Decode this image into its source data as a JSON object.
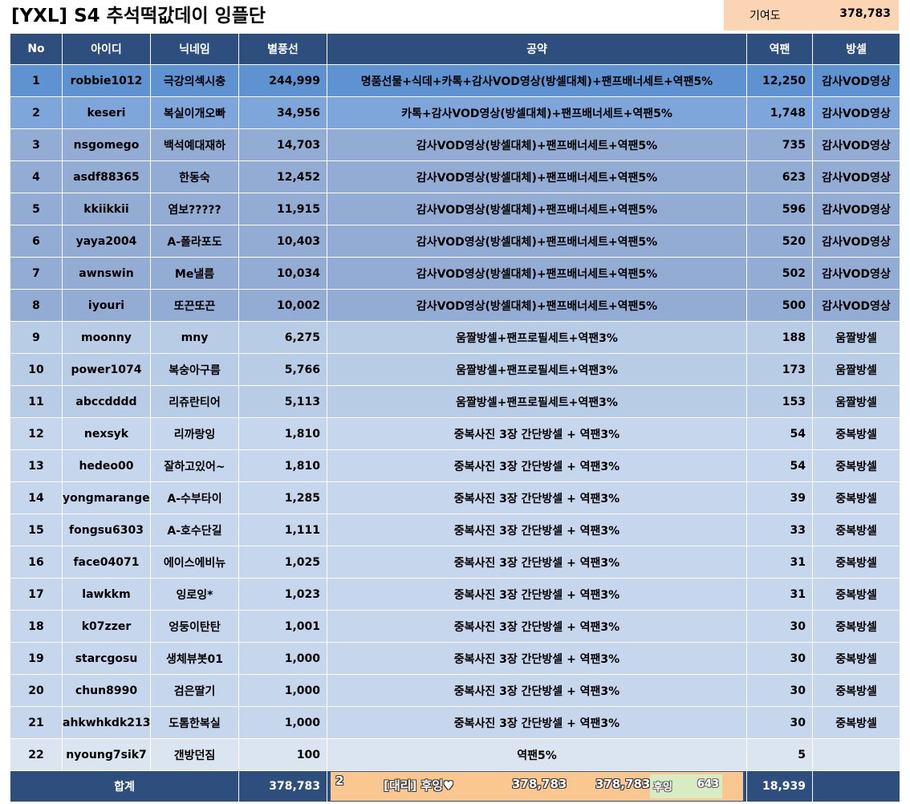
{
  "title": "[YXL] S4 추석떡값데이 잉플단",
  "contribution": {
    "label": "기여도",
    "value": "378,783"
  },
  "headers": [
    "No",
    "아이디",
    "닉네임",
    "별풍선",
    "공약",
    "역팬",
    "방셀"
  ],
  "rows": [
    {
      "no": "1",
      "id": "robbie1012",
      "nick": "극강의섹시충",
      "balloons": "244,999",
      "promise": "명품선물+식데+카톡+감사VOD영상(방셀대체)+팬프배너세트+역팬5%",
      "fan": "12,250",
      "cell": "감사VOD영상",
      "tone": "t1"
    },
    {
      "no": "2",
      "id": "keseri",
      "nick": "복실이개오빠",
      "balloons": "34,956",
      "promise": "카톡+감사VOD영상(방셀대체)+팬프배너세트+역팬5%",
      "fan": "1,748",
      "cell": "감사VOD영상",
      "tone": "t2"
    },
    {
      "no": "3",
      "id": "nsgomego",
      "nick": "백석예대재하",
      "balloons": "14,703",
      "promise": "감사VOD영상(방셀대체)+팬프배너세트+역팬5%",
      "fan": "735",
      "cell": "감사VOD영상",
      "tone": "t3"
    },
    {
      "no": "4",
      "id": "asdf88365",
      "nick": "한동숙",
      "balloons": "12,452",
      "promise": "감사VOD영상(방셀대체)+팬프배너세트+역팬5%",
      "fan": "623",
      "cell": "감사VOD영상",
      "tone": "t3"
    },
    {
      "no": "5",
      "id": "kkiikkii",
      "nick": "염보?????",
      "balloons": "11,915",
      "promise": "감사VOD영상(방셀대체)+팬프배너세트+역팬5%",
      "fan": "596",
      "cell": "감사VOD영상",
      "tone": "t3"
    },
    {
      "no": "6",
      "id": "yaya2004",
      "nick": "A-폴라포도",
      "balloons": "10,403",
      "promise": "감사VOD영상(방셀대체)+팬프배너세트+역팬5%",
      "fan": "520",
      "cell": "감사VOD영상",
      "tone": "t3"
    },
    {
      "no": "7",
      "id": "awnswin",
      "nick": "Me낼름",
      "balloons": "10,034",
      "promise": "감사VOD영상(방셀대체)+팬프배너세트+역팬5%",
      "fan": "502",
      "cell": "감사VOD영상",
      "tone": "t3"
    },
    {
      "no": "8",
      "id": "iyouri",
      "nick": "또끈또끈",
      "balloons": "10,002",
      "promise": "감사VOD영상(방셀대체)+팬프배너세트+역팬5%",
      "fan": "500",
      "cell": "감사VOD영상",
      "tone": "t3"
    },
    {
      "no": "9",
      "id": "moonny",
      "nick": "mny",
      "balloons": "6,275",
      "promise": "움짤방셀+팬프로필세트+역팬3%",
      "fan": "188",
      "cell": "움짤방셀",
      "tone": "t4"
    },
    {
      "no": "10",
      "id": "power1074",
      "nick": "복숭아구름",
      "balloons": "5,766",
      "promise": "움짤방셀+팬프로필세트+역팬3%",
      "fan": "173",
      "cell": "움짤방셀",
      "tone": "t4"
    },
    {
      "no": "11",
      "id": "abccdddd",
      "nick": "리쥬란티어",
      "balloons": "5,113",
      "promise": "움짤방셀+팬프로필세트+역팬3%",
      "fan": "153",
      "cell": "움짤방셀",
      "tone": "t4"
    },
    {
      "no": "12",
      "id": "nexsyk",
      "nick": "리까랑잉",
      "balloons": "1,810",
      "promise": "중복사진 3장 간단방셀 + 역팬3%",
      "fan": "54",
      "cell": "중복방셀",
      "tone": "t5"
    },
    {
      "no": "13",
      "id": "hedeo00",
      "nick": "잘하고있어~",
      "balloons": "1,810",
      "promise": "중복사진 3장 간단방셀 + 역팬3%",
      "fan": "54",
      "cell": "중복방셀",
      "tone": "t5"
    },
    {
      "no": "14",
      "id": "yongmaranger",
      "nick": "A-수부타이",
      "balloons": "1,285",
      "promise": "중복사진 3장 간단방셀 + 역팬3%",
      "fan": "39",
      "cell": "중복방셀",
      "tone": "t5"
    },
    {
      "no": "15",
      "id": "fongsu6303",
      "nick": "A-호수단길",
      "balloons": "1,111",
      "promise": "중복사진 3장 간단방셀 + 역팬3%",
      "fan": "33",
      "cell": "중복방셀",
      "tone": "t5"
    },
    {
      "no": "16",
      "id": "face04071",
      "nick": "에이스에비뉴",
      "balloons": "1,025",
      "promise": "중복사진 3장 간단방셀 + 역팬3%",
      "fan": "31",
      "cell": "중복방셀",
      "tone": "t5"
    },
    {
      "no": "17",
      "id": "lawkkm",
      "nick": "잉로잉*",
      "balloons": "1,023",
      "promise": "중복사진 3장 간단방셀 + 역팬3%",
      "fan": "31",
      "cell": "중복방셀",
      "tone": "t5"
    },
    {
      "no": "18",
      "id": "k07zzer",
      "nick": "엉둥이탄탄",
      "balloons": "1,001",
      "promise": "중복사진 3장 간단방셀 + 역팬3%",
      "fan": "30",
      "cell": "중복방셀",
      "tone": "t5"
    },
    {
      "no": "19",
      "id": "starcgosu",
      "nick": "생체뷰봇01",
      "balloons": "1,000",
      "promise": "중복사진 3장 간단방셀 + 역팬3%",
      "fan": "30",
      "cell": "중복방셀",
      "tone": "t5"
    },
    {
      "no": "20",
      "id": "chun8990",
      "nick": "검은딸기",
      "balloons": "1,000",
      "promise": "중복사진 3장 간단방셀 + 역팬3%",
      "fan": "30",
      "cell": "중복방셀",
      "tone": "t5"
    },
    {
      "no": "21",
      "id": "ahkwhkdk213",
      "nick": "도톰한복실",
      "balloons": "1,000",
      "promise": "중복사진 3장 간단방셀 + 역팬3%",
      "fan": "30",
      "cell": "중복방셀",
      "tone": "t5"
    },
    {
      "no": "22",
      "id": "nyoung7sik7",
      "nick": "갠방던짐",
      "balloons": "100",
      "promise": "역팬5%",
      "fan": "5",
      "cell": "",
      "tone": "t6"
    }
  ],
  "total": {
    "label": "합계",
    "balloons": "378,783",
    "fan": "18,939",
    "sponsor": {
      "num": "2",
      "name": "[대리] 후잉♥",
      "value1": "378,783",
      "value2": "378,783",
      "box_label": "후잉",
      "box_value": "643"
    }
  }
}
